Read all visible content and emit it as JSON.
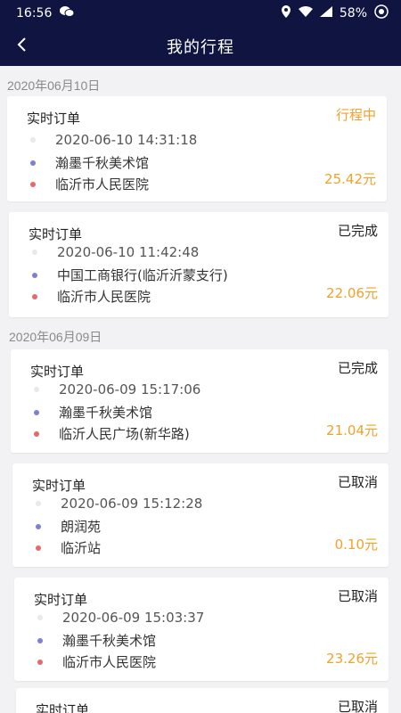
{
  "status_bar": {
    "time": "16:56",
    "battery": "58%",
    "icons": [
      "wechat-icon",
      "location-icon",
      "wifi-icon",
      "signal-icon",
      "battery-icon"
    ]
  },
  "header": {
    "back_icon": "back-arrow-icon",
    "title": "我的行程"
  },
  "colors": {
    "header_bg": "#0f1540",
    "accent_orange": "#f0a22a",
    "start_dot": "#7d7fd8",
    "end_dot": "#e46a6a"
  },
  "groups": [
    {
      "date": "2020年06月10日",
      "orders": [
        {
          "type": "实时订单",
          "status": "行程中",
          "time": "2020-06-10 14:31:18",
          "start": "瀚墨千秋美术馆",
          "end": "临沂市人民医院",
          "price": "25.42元"
        },
        {
          "type": "实时订单",
          "status": "已完成",
          "time": "2020-06-10 11:42:48",
          "start": "中国工商银行(临沂沂蒙支行)",
          "end": "临沂市人民医院",
          "price": "22.06元"
        }
      ]
    },
    {
      "date": "2020年06月09日",
      "orders": [
        {
          "type": "实时订单",
          "status": "已完成",
          "time": "2020-06-09 15:17:06",
          "start": "瀚墨千秋美术馆",
          "end": "临沂人民广场(新华路)",
          "price": "21.04元"
        },
        {
          "type": "实时订单",
          "status": "已取消",
          "time": "2020-06-09 15:12:28",
          "start": "朗润苑",
          "end": "临沂站",
          "price": "0.10元"
        },
        {
          "type": "实时订单",
          "status": "已取消",
          "time": "2020-06-09 15:03:37",
          "start": "瀚墨千秋美术馆",
          "end": "临沂市人民医院",
          "price": "23.26元"
        },
        {
          "type": "实时订单",
          "status": "已取消"
        }
      ]
    }
  ]
}
